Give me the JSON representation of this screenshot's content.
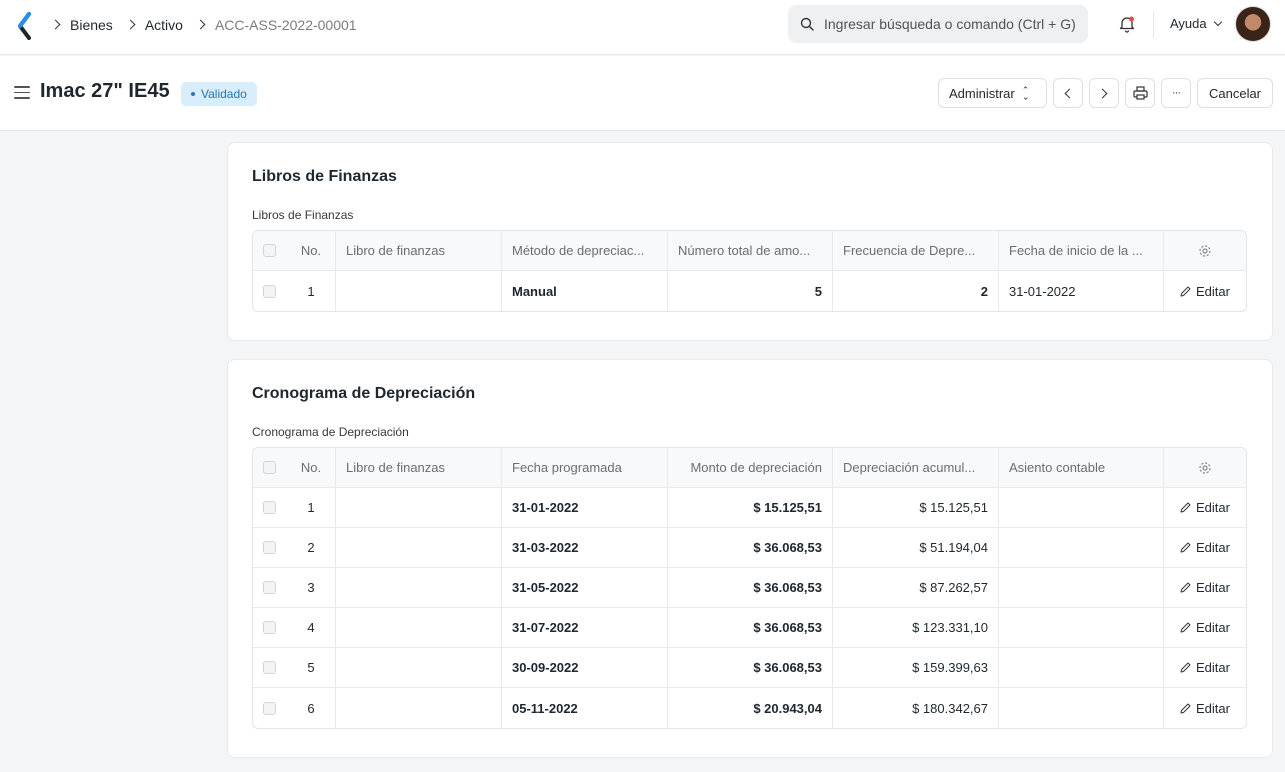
{
  "navbar": {
    "breadcrumbs": [
      "Bienes",
      "Activo",
      "ACC-ASS-2022-00001"
    ],
    "search_placeholder": "Ingresar búsqueda o comando (Ctrl + G)",
    "help_label": "Ayuda"
  },
  "page": {
    "title": "Imac 27\" IE45",
    "status": "Validado",
    "admin_label": "Administrar",
    "more_label": "···",
    "cancel_label": "Cancelar"
  },
  "finance_books": {
    "section_title": "Libros de Finanzas",
    "table_label": "Libros de Finanzas",
    "columns": [
      "No.",
      "Libro de finanzas",
      "Método de depreciac...",
      "Número total de amo...",
      "Frecuencia de Depre...",
      "Fecha de inicio de la ..."
    ],
    "rows": [
      {
        "no": "1",
        "book": "",
        "method": "Manual",
        "total": "5",
        "frequency": "2",
        "start_date": "31-01-2022",
        "action": "Editar"
      }
    ]
  },
  "schedule": {
    "section_title": "Cronograma de Depreciación",
    "table_label": "Cronograma de Depreciación",
    "columns": [
      "No.",
      "Libro de finanzas",
      "Fecha programada",
      "Monto de depreciación",
      "Depreciación acumul...",
      "Asiento contable"
    ],
    "rows": [
      {
        "no": "1",
        "book": "",
        "date": "31-01-2022",
        "amount": "$ 15.125,51",
        "accumulated": "$ 15.125,51",
        "entry": "",
        "action": "Editar"
      },
      {
        "no": "2",
        "book": "",
        "date": "31-03-2022",
        "amount": "$ 36.068,53",
        "accumulated": "$ 51.194,04",
        "entry": "",
        "action": "Editar"
      },
      {
        "no": "3",
        "book": "",
        "date": "31-05-2022",
        "amount": "$ 36.068,53",
        "accumulated": "$ 87.262,57",
        "entry": "",
        "action": "Editar"
      },
      {
        "no": "4",
        "book": "",
        "date": "31-07-2022",
        "amount": "$ 36.068,53",
        "accumulated": "$ 123.331,10",
        "entry": "",
        "action": "Editar"
      },
      {
        "no": "5",
        "book": "",
        "date": "30-09-2022",
        "amount": "$ 36.068,53",
        "accumulated": "$ 159.399,63",
        "entry": "",
        "action": "Editar"
      },
      {
        "no": "6",
        "book": "",
        "date": "05-11-2022",
        "amount": "$ 20.943,04",
        "accumulated": "$ 180.342,67",
        "entry": "",
        "action": "Editar"
      }
    ]
  }
}
